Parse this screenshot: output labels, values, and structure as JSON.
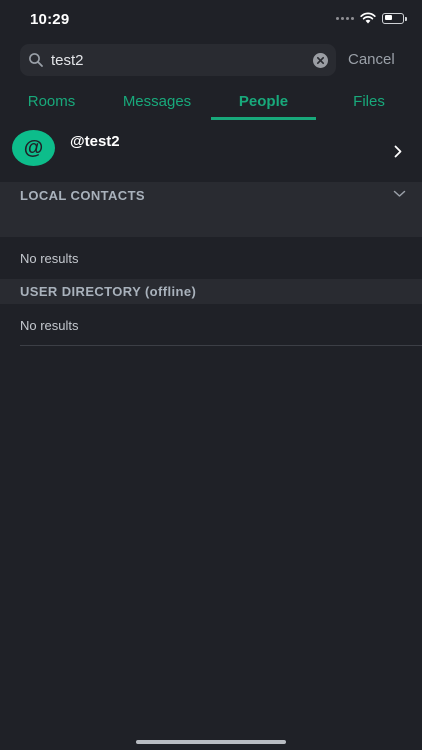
{
  "status_bar": {
    "time": "10:29",
    "battery_level": 0.45
  },
  "search": {
    "value": "test2",
    "cancel_label": "Cancel"
  },
  "tabs": [
    {
      "label": "Rooms",
      "active": false
    },
    {
      "label": "Messages",
      "active": false
    },
    {
      "label": "People",
      "active": true
    },
    {
      "label": "Files",
      "active": false
    }
  ],
  "result": {
    "avatar_text": "@",
    "name": "@test2"
  },
  "sections": {
    "local_contacts": {
      "title": "LOCAL CONTACTS",
      "empty_text": "No results"
    },
    "user_directory": {
      "title": "USER DIRECTORY (offline)",
      "empty_text": "No results"
    }
  },
  "colors": {
    "background": "#1f2127",
    "accent": "#0dbd8b",
    "section_bg": "#292b31"
  }
}
